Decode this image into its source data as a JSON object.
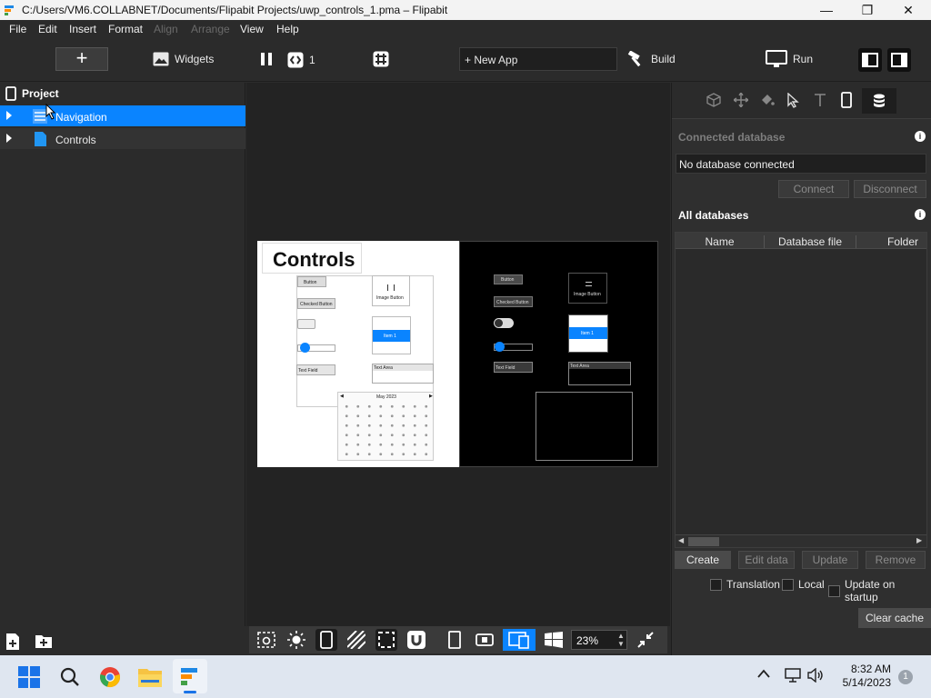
{
  "window": {
    "title": "C:/Users/VM6.COLLABNET/Documents/Flipabit Projects/uwp_controls_1.pma – Flipabit",
    "minimize_glyph": "—",
    "maximize_glyph": "❐",
    "close_glyph": "✕"
  },
  "menubar": {
    "items": [
      "File",
      "Edit",
      "Insert",
      "Format",
      "Align",
      "Arrange",
      "View",
      "Help"
    ]
  },
  "toolbar": {
    "add_glyph": "+",
    "widgets_label": "Widgets",
    "page_count": "1",
    "new_app_label": "+ New App",
    "build_label": "Build",
    "run_label": "Run"
  },
  "project": {
    "header": "Project",
    "items": [
      {
        "label": "Navigation",
        "selected": true
      },
      {
        "label": "Controls",
        "selected": false
      }
    ]
  },
  "canvas": {
    "controls_title": "Controls",
    "light": {
      "button": "Button",
      "checked_button": "Checked Button",
      "image_button": "Image Button",
      "item": "Item 1",
      "text_field": "Text Field",
      "text_area": "Text Area",
      "calendar_month": "May 2023"
    },
    "dark": {
      "button": "Button",
      "checked_button": "Checked Button",
      "image_button": "Image Button",
      "item": "Item 1",
      "text_field": "Text Field",
      "text_area": "Text Area"
    }
  },
  "bottom": {
    "zoom": "23%"
  },
  "right_panel": {
    "connected_db_label": "Connected database",
    "db_value": "No database connected",
    "connect": "Connect",
    "disconnect": "Disconnect",
    "all_db_label": "All databases",
    "columns": [
      "Name",
      "Database file",
      "Folder"
    ],
    "create": "Create",
    "edit_data": "Edit data",
    "update": "Update",
    "remove": "Remove",
    "translation": "Translation",
    "local": "Local",
    "update_on_startup": "Update on startup",
    "clear_cache": "Clear cache"
  },
  "taskbar": {
    "time": "8:32 AM",
    "date": "5/14/2023",
    "notifications": "1"
  },
  "colors": {
    "accent": "#0a84ff",
    "panel": "#2b2b2b",
    "canvas": "#232323"
  }
}
